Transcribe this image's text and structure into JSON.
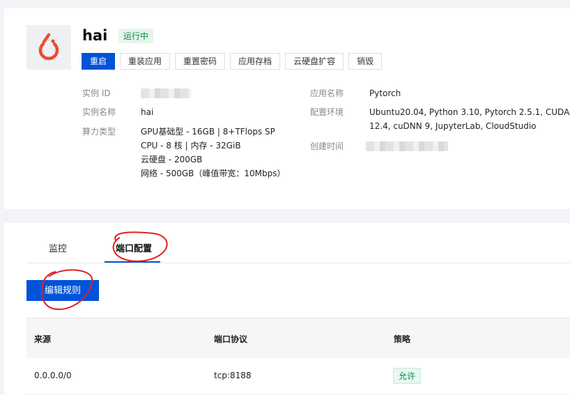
{
  "instance": {
    "title": "hai",
    "status": "运行中"
  },
  "actions": [
    "重启",
    "重装应用",
    "重置密码",
    "应用存档",
    "云硬盘扩容",
    "销毁"
  ],
  "info_left": {
    "id_label": "实例 ID",
    "name_label": "实例名称",
    "name_value": "hai",
    "type_label": "算力类型",
    "type_lines": [
      "GPU基础型 - 16GB | 8+TFlops SP",
      "CPU - 8 核 | 内存 - 32GiB",
      "云硬盘 - 200GB",
      "网络 - 500GB（峰值带宽：10Mbps）"
    ]
  },
  "info_right": {
    "app_label": "应用名称",
    "app_value": "Pytorch",
    "env_label": "配置环境",
    "env_lines": [
      "Ubuntu20.04, Python 3.10, Pytorch 2.5.1, CUDA",
      "12.4, cuDNN 9, JupyterLab, CloudStudio"
    ],
    "created_label": "创建时间"
  },
  "tabs": {
    "monitor": "监控",
    "ports": "端口配置"
  },
  "edit_button": "编辑规则",
  "table": {
    "headers": [
      "来源",
      "端口协议",
      "策略"
    ],
    "rows": [
      {
        "source": "0.0.0.0/0",
        "protocol": "tcp:8188",
        "policy": "允许"
      }
    ]
  },
  "colors": {
    "primary": "#0052d9",
    "success": "#0a8a4a",
    "logo": "#ee4c2c",
    "annotation": "#e02020"
  },
  "icons": {
    "logo": "pytorch-logo-icon"
  }
}
